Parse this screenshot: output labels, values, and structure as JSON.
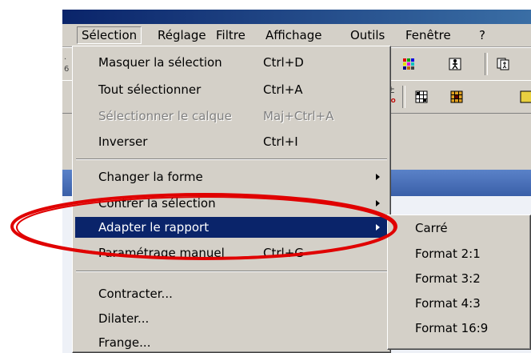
{
  "menubar": {
    "items": [
      {
        "label": "Sélection",
        "active": true
      },
      {
        "label": "Réglage"
      },
      {
        "label": "Filtre"
      },
      {
        "label": "Affichage"
      },
      {
        "label": "Outils"
      },
      {
        "label": "Fenêtre"
      },
      {
        "label": "?"
      }
    ]
  },
  "toolbar": {
    "left_label_top": "·",
    "left_label_bottom": "6",
    "row2_symbol": "±",
    "row2_symbol_sub": "TO"
  },
  "selection_menu": {
    "items": [
      {
        "label": "Masquer la sélection",
        "shortcut": "Ctrl+D"
      },
      {
        "label": "Tout sélectionner",
        "shortcut": "Ctrl+A"
      },
      {
        "label": "Sélectionner le calque",
        "shortcut": "Maj+Ctrl+A",
        "disabled": true
      },
      {
        "label": "Inverser",
        "shortcut": "Ctrl+I"
      },
      {
        "label": "Changer la forme",
        "submenu": true
      },
      {
        "label": "Contrer la sélection",
        "submenu": true
      },
      {
        "label": "Adapter le rapport",
        "submenu": true,
        "highlighted": true
      },
      {
        "label": "Paramétrage manuel",
        "shortcut": "Ctrl+G"
      },
      {
        "label": "Contracter..."
      },
      {
        "label": "Dilater..."
      },
      {
        "label": "Frange..."
      }
    ]
  },
  "ratio_submenu": {
    "items": [
      {
        "label": "Carré"
      },
      {
        "label": "Format 2:1"
      },
      {
        "label": "Format 3:2"
      },
      {
        "label": "Format 4:3"
      },
      {
        "label": "Format 16:9"
      }
    ]
  },
  "colors": {
    "menu_bg": "#d4d0c8",
    "highlight_bg": "#0a246a",
    "highlight_text": "#ffffff",
    "disabled_text": "#808080",
    "annotation_ellipse": "#e00000",
    "titlebar": "#0a246a"
  }
}
